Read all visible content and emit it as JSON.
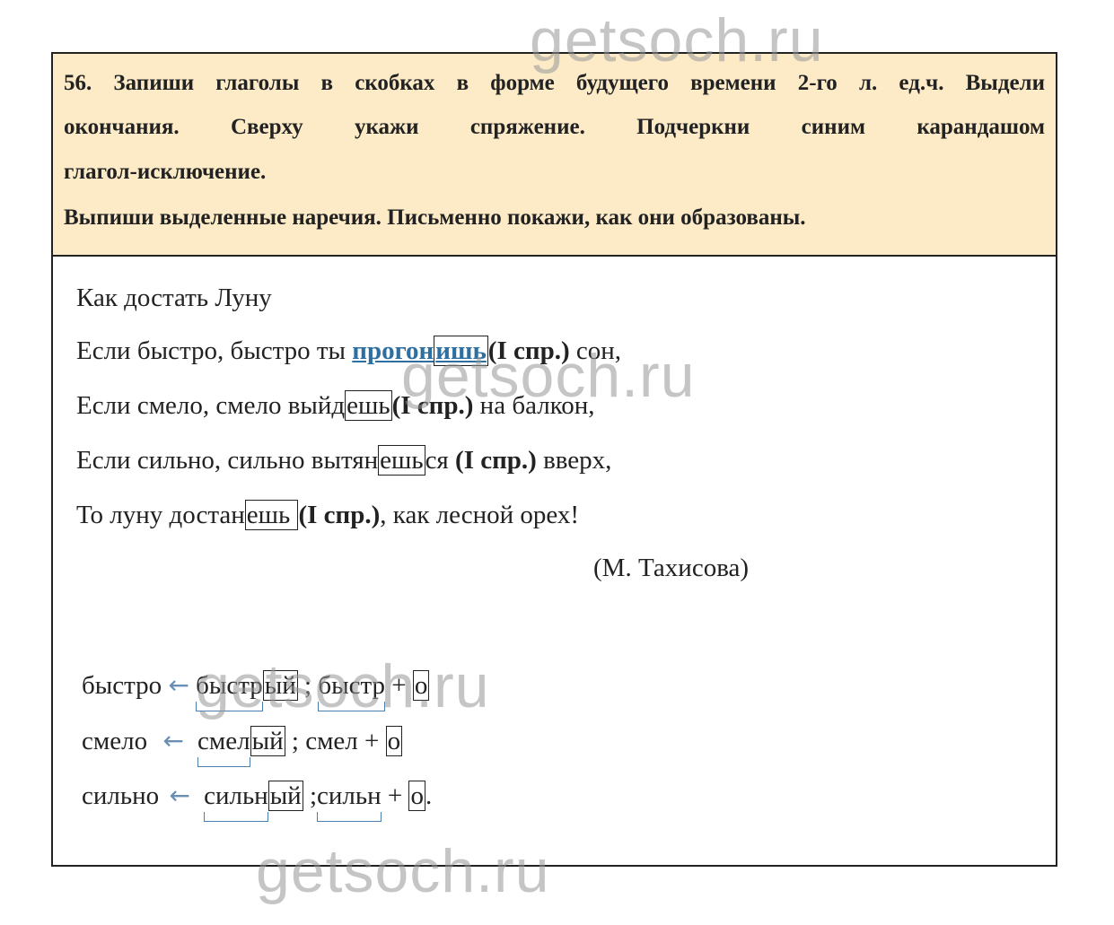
{
  "watermark": "getsoch.ru",
  "task": {
    "line1": "56. Запиши глаголы в скобках в форме будущего времени 2-го л. ед.ч. Выдели",
    "line2": "окончания. Сверху укажи спряжение. Подчеркни синим карандашом",
    "line3": "глагол-исключение.",
    "line4": "Выпиши выделенные наречия. Письменно покажи, как они образованы."
  },
  "poem": {
    "title": "Как достать Луну",
    "l1": {
      "pre": "Если быстро, быстро ты ",
      "stem": "прогон",
      "ending": "ишь",
      "conj": "(I спр.)",
      "post": " сон,"
    },
    "l2": {
      "pre": "Если смело, смело выйд",
      "ending": "ешь",
      "conj": "(I спр.)",
      "post": " на балкон,"
    },
    "l3": {
      "pre": "Если сильно, сильно вытян",
      "ending": "ешь",
      "suffix": "ся ",
      "conj": "(I спр.)",
      "post": " вверх,"
    },
    "l4": {
      "pre": "То луну достан",
      "ending": "ешь",
      "gap": " ",
      "conj": "(I спр.)",
      "post": ", как лесной орех!"
    },
    "author": "(М. Тахисова)"
  },
  "derivation": [
    {
      "adverb": "быстро",
      "arrow": "←",
      "adj_stem": "быстр",
      "adj_end": "ый",
      "sep": " ; ",
      "root": "быстр",
      "plus": " + ",
      "suffix": "о",
      "tail": ""
    },
    {
      "adverb": "смело",
      "arrow": "←",
      "adj_stem": "смел",
      "adj_end": "ый",
      "sep": " ; ",
      "root": "смел",
      "plus": " + ",
      "suffix": "о",
      "tail": ""
    },
    {
      "adverb": "сильно",
      "arrow": "←",
      "adj_stem": "сильн",
      "adj_end": "ый",
      "sep": " ;",
      "root": "сильн",
      "plus": " + ",
      "suffix": "о",
      "tail": "."
    }
  ]
}
